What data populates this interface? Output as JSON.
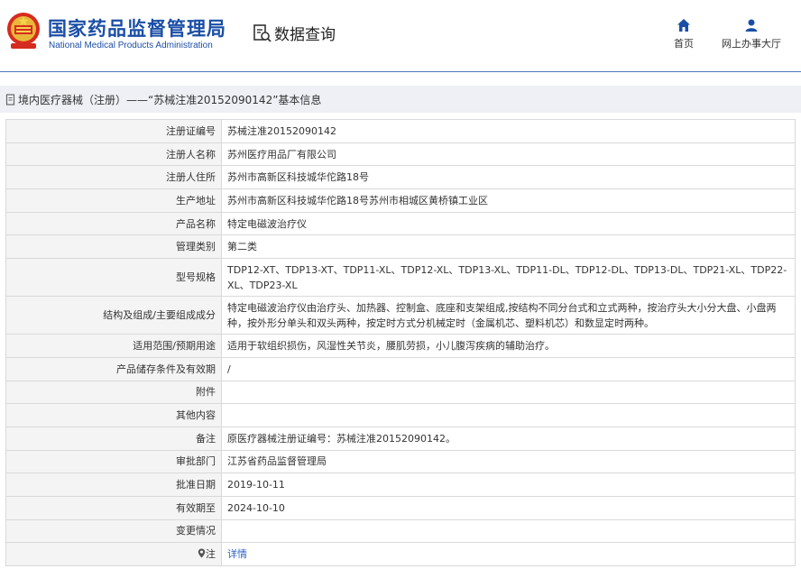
{
  "header": {
    "title_cn": "国家药品监督管理局",
    "title_en": "National Medical Products Administration",
    "search_title": "数据查询",
    "nav": [
      {
        "label": "首页",
        "icon": "home-icon"
      },
      {
        "label": "网上办事大厅",
        "icon": "user-icon"
      }
    ]
  },
  "breadcrumb": "境内医疗器械（注册）——“苏械注准20152090142”基本信息",
  "rows": [
    {
      "label": "注册证编号",
      "value": "苏械注准20152090142"
    },
    {
      "label": "注册人名称",
      "value": "苏州医疗用品厂有限公司"
    },
    {
      "label": "注册人住所",
      "value": "苏州市高新区科技城华佗路18号"
    },
    {
      "label": "生产地址",
      "value": "苏州市高新区科技城华佗路18号苏州市相城区黄桥镇工业区"
    },
    {
      "label": "产品名称",
      "value": "特定电磁波治疗仪"
    },
    {
      "label": "管理类别",
      "value": "第二类"
    },
    {
      "label": "型号规格",
      "value": "TDP12-XT、TDP13-XT、TDP11-XL、TDP12-XL、TDP13-XL、TDP11-DL、TDP12-DL、TDP13-DL、TDP21-XL、TDP22-XL、TDP23-XL"
    },
    {
      "label": "结构及组成/主要组成成分",
      "value": "特定电磁波治疗仪由治疗头、加热器、控制盒、底座和支架组成,按结构不同分台式和立式两种，按治疗头大小分大盘、小盘两种，按外形分单头和双头两种，按定时方式分机械定时（金属机芯、塑料机芯）和数显定时两种。"
    },
    {
      "label": "适用范围/预期用途",
      "value": "适用于软组织损伤，风湿性关节炎，腰肌劳损，小儿腹泻疾病的辅助治疗。"
    },
    {
      "label": "产品储存条件及有效期",
      "value": "/"
    },
    {
      "label": "附件",
      "value": ""
    },
    {
      "label": "其他内容",
      "value": ""
    },
    {
      "label": "备注",
      "value": "原医疗器械注册证编号：苏械注准20152090142。"
    },
    {
      "label": "审批部门",
      "value": "江苏省药品监督管理局"
    },
    {
      "label": "批准日期",
      "value": "2019-10-11"
    },
    {
      "label": "有效期至",
      "value": "2024-10-10"
    },
    {
      "label": "变更情况",
      "value": ""
    },
    {
      "label": "注",
      "value": "详情"
    }
  ],
  "colors": {
    "brand": "#1a4ea6",
    "link": "#2a62c9",
    "label_bg": "#f4f4f4",
    "bar_bg": "#eef0f5"
  }
}
